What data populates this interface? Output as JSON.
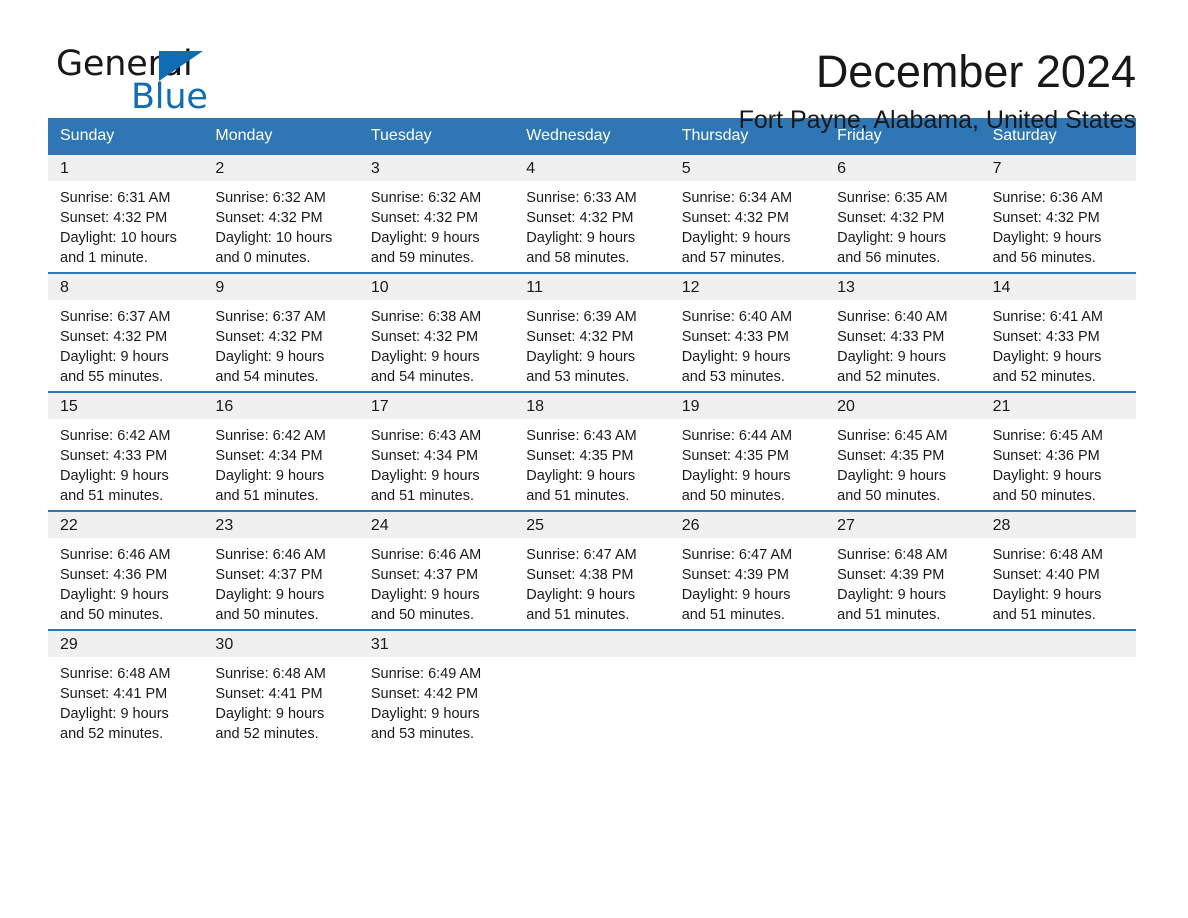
{
  "brand": {
    "word_one": "General",
    "word_two": "Blue",
    "triangle_color": "#0f6cb5",
    "logo_icon": "general-blue-triangle-logo"
  },
  "header": {
    "month_title": "December 2024",
    "location": "Fort Payne, Alabama, United States"
  },
  "colors": {
    "header_blue": "#2f76b5",
    "row_divider_blue": "#2f76b5",
    "day_band_gray": "#f0f0f0",
    "text": "#1a1a1a",
    "brand_blue": "#0f6cb5"
  },
  "calendar": {
    "weekdays": [
      "Sunday",
      "Monday",
      "Tuesday",
      "Wednesday",
      "Thursday",
      "Friday",
      "Saturday"
    ],
    "weeks": [
      [
        {
          "day": "1",
          "sunrise": "Sunrise: 6:31 AM",
          "sunset": "Sunset: 4:32 PM",
          "daylight_line1": "Daylight: 10 hours",
          "daylight_line2": "and 1 minute."
        },
        {
          "day": "2",
          "sunrise": "Sunrise: 6:32 AM",
          "sunset": "Sunset: 4:32 PM",
          "daylight_line1": "Daylight: 10 hours",
          "daylight_line2": "and 0 minutes."
        },
        {
          "day": "3",
          "sunrise": "Sunrise: 6:32 AM",
          "sunset": "Sunset: 4:32 PM",
          "daylight_line1": "Daylight: 9 hours",
          "daylight_line2": "and 59 minutes."
        },
        {
          "day": "4",
          "sunrise": "Sunrise: 6:33 AM",
          "sunset": "Sunset: 4:32 PM",
          "daylight_line1": "Daylight: 9 hours",
          "daylight_line2": "and 58 minutes."
        },
        {
          "day": "5",
          "sunrise": "Sunrise: 6:34 AM",
          "sunset": "Sunset: 4:32 PM",
          "daylight_line1": "Daylight: 9 hours",
          "daylight_line2": "and 57 minutes."
        },
        {
          "day": "6",
          "sunrise": "Sunrise: 6:35 AM",
          "sunset": "Sunset: 4:32 PM",
          "daylight_line1": "Daylight: 9 hours",
          "daylight_line2": "and 56 minutes."
        },
        {
          "day": "7",
          "sunrise": "Sunrise: 6:36 AM",
          "sunset": "Sunset: 4:32 PM",
          "daylight_line1": "Daylight: 9 hours",
          "daylight_line2": "and 56 minutes."
        }
      ],
      [
        {
          "day": "8",
          "sunrise": "Sunrise: 6:37 AM",
          "sunset": "Sunset: 4:32 PM",
          "daylight_line1": "Daylight: 9 hours",
          "daylight_line2": "and 55 minutes."
        },
        {
          "day": "9",
          "sunrise": "Sunrise: 6:37 AM",
          "sunset": "Sunset: 4:32 PM",
          "daylight_line1": "Daylight: 9 hours",
          "daylight_line2": "and 54 minutes."
        },
        {
          "day": "10",
          "sunrise": "Sunrise: 6:38 AM",
          "sunset": "Sunset: 4:32 PM",
          "daylight_line1": "Daylight: 9 hours",
          "daylight_line2": "and 54 minutes."
        },
        {
          "day": "11",
          "sunrise": "Sunrise: 6:39 AM",
          "sunset": "Sunset: 4:32 PM",
          "daylight_line1": "Daylight: 9 hours",
          "daylight_line2": "and 53 minutes."
        },
        {
          "day": "12",
          "sunrise": "Sunrise: 6:40 AM",
          "sunset": "Sunset: 4:33 PM",
          "daylight_line1": "Daylight: 9 hours",
          "daylight_line2": "and 53 minutes."
        },
        {
          "day": "13",
          "sunrise": "Sunrise: 6:40 AM",
          "sunset": "Sunset: 4:33 PM",
          "daylight_line1": "Daylight: 9 hours",
          "daylight_line2": "and 52 minutes."
        },
        {
          "day": "14",
          "sunrise": "Sunrise: 6:41 AM",
          "sunset": "Sunset: 4:33 PM",
          "daylight_line1": "Daylight: 9 hours",
          "daylight_line2": "and 52 minutes."
        }
      ],
      [
        {
          "day": "15",
          "sunrise": "Sunrise: 6:42 AM",
          "sunset": "Sunset: 4:33 PM",
          "daylight_line1": "Daylight: 9 hours",
          "daylight_line2": "and 51 minutes."
        },
        {
          "day": "16",
          "sunrise": "Sunrise: 6:42 AM",
          "sunset": "Sunset: 4:34 PM",
          "daylight_line1": "Daylight: 9 hours",
          "daylight_line2": "and 51 minutes."
        },
        {
          "day": "17",
          "sunrise": "Sunrise: 6:43 AM",
          "sunset": "Sunset: 4:34 PM",
          "daylight_line1": "Daylight: 9 hours",
          "daylight_line2": "and 51 minutes."
        },
        {
          "day": "18",
          "sunrise": "Sunrise: 6:43 AM",
          "sunset": "Sunset: 4:35 PM",
          "daylight_line1": "Daylight: 9 hours",
          "daylight_line2": "and 51 minutes."
        },
        {
          "day": "19",
          "sunrise": "Sunrise: 6:44 AM",
          "sunset": "Sunset: 4:35 PM",
          "daylight_line1": "Daylight: 9 hours",
          "daylight_line2": "and 50 minutes."
        },
        {
          "day": "20",
          "sunrise": "Sunrise: 6:45 AM",
          "sunset": "Sunset: 4:35 PM",
          "daylight_line1": "Daylight: 9 hours",
          "daylight_line2": "and 50 minutes."
        },
        {
          "day": "21",
          "sunrise": "Sunrise: 6:45 AM",
          "sunset": "Sunset: 4:36 PM",
          "daylight_line1": "Daylight: 9 hours",
          "daylight_line2": "and 50 minutes."
        }
      ],
      [
        {
          "day": "22",
          "sunrise": "Sunrise: 6:46 AM",
          "sunset": "Sunset: 4:36 PM",
          "daylight_line1": "Daylight: 9 hours",
          "daylight_line2": "and 50 minutes."
        },
        {
          "day": "23",
          "sunrise": "Sunrise: 6:46 AM",
          "sunset": "Sunset: 4:37 PM",
          "daylight_line1": "Daylight: 9 hours",
          "daylight_line2": "and 50 minutes."
        },
        {
          "day": "24",
          "sunrise": "Sunrise: 6:46 AM",
          "sunset": "Sunset: 4:37 PM",
          "daylight_line1": "Daylight: 9 hours",
          "daylight_line2": "and 50 minutes."
        },
        {
          "day": "25",
          "sunrise": "Sunrise: 6:47 AM",
          "sunset": "Sunset: 4:38 PM",
          "daylight_line1": "Daylight: 9 hours",
          "daylight_line2": "and 51 minutes."
        },
        {
          "day": "26",
          "sunrise": "Sunrise: 6:47 AM",
          "sunset": "Sunset: 4:39 PM",
          "daylight_line1": "Daylight: 9 hours",
          "daylight_line2": "and 51 minutes."
        },
        {
          "day": "27",
          "sunrise": "Sunrise: 6:48 AM",
          "sunset": "Sunset: 4:39 PM",
          "daylight_line1": "Daylight: 9 hours",
          "daylight_line2": "and 51 minutes."
        },
        {
          "day": "28",
          "sunrise": "Sunrise: 6:48 AM",
          "sunset": "Sunset: 4:40 PM",
          "daylight_line1": "Daylight: 9 hours",
          "daylight_line2": "and 51 minutes."
        }
      ],
      [
        {
          "day": "29",
          "sunrise": "Sunrise: 6:48 AM",
          "sunset": "Sunset: 4:41 PM",
          "daylight_line1": "Daylight: 9 hours",
          "daylight_line2": "and 52 minutes."
        },
        {
          "day": "30",
          "sunrise": "Sunrise: 6:48 AM",
          "sunset": "Sunset: 4:41 PM",
          "daylight_line1": "Daylight: 9 hours",
          "daylight_line2": "and 52 minutes."
        },
        {
          "day": "31",
          "sunrise": "Sunrise: 6:49 AM",
          "sunset": "Sunset: 4:42 PM",
          "daylight_line1": "Daylight: 9 hours",
          "daylight_line2": "and 53 minutes."
        },
        {
          "day": "",
          "sunrise": "",
          "sunset": "",
          "daylight_line1": "",
          "daylight_line2": ""
        },
        {
          "day": "",
          "sunrise": "",
          "sunset": "",
          "daylight_line1": "",
          "daylight_line2": ""
        },
        {
          "day": "",
          "sunrise": "",
          "sunset": "",
          "daylight_line1": "",
          "daylight_line2": ""
        },
        {
          "day": "",
          "sunrise": "",
          "sunset": "",
          "daylight_line1": "",
          "daylight_line2": ""
        }
      ]
    ]
  }
}
